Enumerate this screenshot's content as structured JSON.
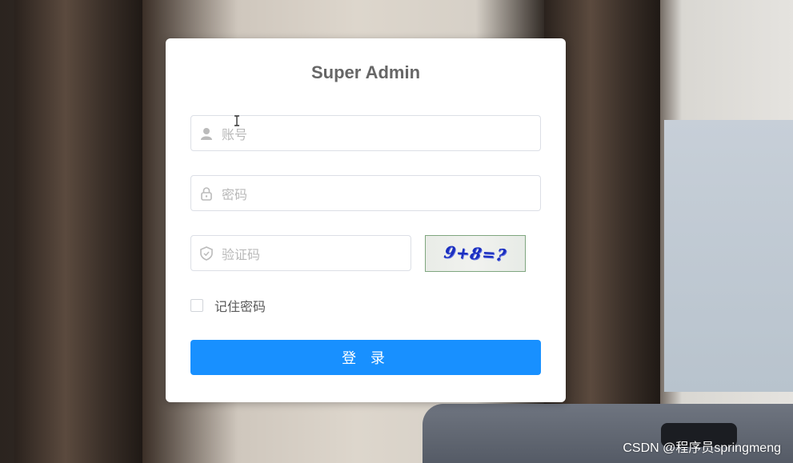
{
  "form": {
    "title": "Super Admin",
    "username_placeholder": "账号",
    "password_placeholder": "密码",
    "captcha_placeholder": "验证码",
    "captcha_text": "9+8=?",
    "remember_label": "记住密码",
    "login_label": "登 录"
  },
  "watermark": "CSDN @程序员springmeng",
  "icons": {
    "username": "user-icon",
    "password": "lock-icon",
    "captcha": "shield-icon",
    "cursor": "text-cursor-icon"
  },
  "colors": {
    "primary": "#1890ff",
    "captcha_text": "#1b2fbf"
  }
}
